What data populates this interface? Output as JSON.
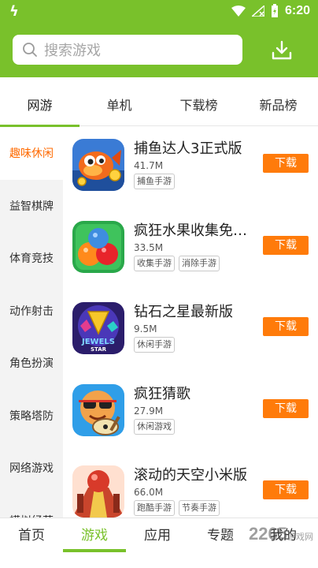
{
  "status_bar": {
    "time": "6:20"
  },
  "search": {
    "placeholder": "搜索游戏"
  },
  "tabs": [
    {
      "label": "网游",
      "active": true
    },
    {
      "label": "单机",
      "active": false
    },
    {
      "label": "下载榜",
      "active": false
    },
    {
      "label": "新品榜",
      "active": false
    }
  ],
  "categories": [
    {
      "label": "趣味休闲",
      "active": true
    },
    {
      "label": "益智棋牌",
      "active": false
    },
    {
      "label": "体育竞技",
      "active": false
    },
    {
      "label": "动作射击",
      "active": false
    },
    {
      "label": "角色扮演",
      "active": false
    },
    {
      "label": "策略塔防",
      "active": false
    },
    {
      "label": "网络游戏",
      "active": false
    },
    {
      "label": "模拟经营",
      "active": false
    }
  ],
  "games": [
    {
      "name": "捕鱼达人3正式版",
      "size": "41.7M",
      "tags": [
        "捕鱼手游"
      ],
      "button": "下载",
      "icon": "fish-game-icon"
    },
    {
      "name": "疯狂水果收集免…",
      "size": "33.5M",
      "tags": [
        "收集手游",
        "消除手游"
      ],
      "button": "下载",
      "icon": "fruit-game-icon"
    },
    {
      "name": "钻石之星最新版",
      "size": "9.5M",
      "tags": [
        "休闲手游"
      ],
      "button": "下载",
      "icon": "jewels-game-icon"
    },
    {
      "name": "疯狂猜歌",
      "size": "27.9M",
      "tags": [
        "休闲游戏"
      ],
      "button": "下载",
      "icon": "guess-song-icon"
    },
    {
      "name": "滚动的天空小米版",
      "size": "66.0M",
      "tags": [
        "跑酷手游",
        "节奏手游"
      ],
      "button": "下载",
      "icon": "rolling-sky-icon"
    }
  ],
  "bottom_nav": [
    {
      "label": "首页",
      "active": false
    },
    {
      "label": "游戏",
      "active": true
    },
    {
      "label": "应用",
      "active": false
    },
    {
      "label": "专题",
      "active": false
    },
    {
      "label": "我的",
      "active": false
    }
  ],
  "watermark": {
    "brand": "2265",
    "suffix": "游戏网"
  },
  "colors": {
    "brand_green": "#79c12b",
    "accent_orange": "#ff7b0a"
  }
}
